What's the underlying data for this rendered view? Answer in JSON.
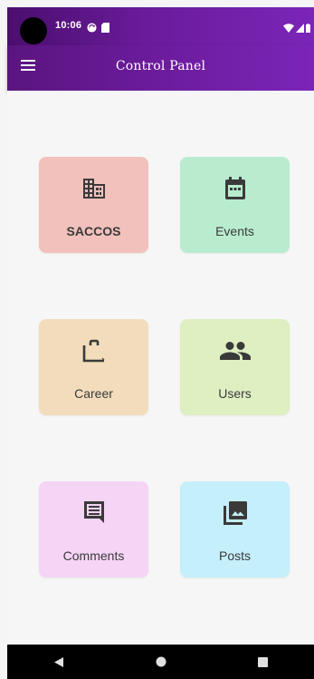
{
  "status_bar": {
    "time": "10:06",
    "icons": [
      "sync-icon",
      "sd-card-icon",
      "wifi-icon",
      "signal-icon",
      "battery-icon"
    ]
  },
  "app_bar": {
    "title": "Control Panel",
    "menu_icon": "menu-icon",
    "gradient": [
      "#5a157e",
      "#7b25b8"
    ]
  },
  "tiles": [
    {
      "label": "SACCOS",
      "icon": "business-icon",
      "color": "#f2c1bc"
    },
    {
      "label": "Events",
      "icon": "calendar-icon",
      "color": "#b9eccf"
    },
    {
      "label": "Career",
      "icon": "work-icon",
      "color": "#f2dcbb"
    },
    {
      "label": "Users",
      "icon": "people-icon",
      "color": "#deefc2"
    },
    {
      "label": "Comments",
      "icon": "comment-icon",
      "color": "#f6d4f5"
    },
    {
      "label": "Posts",
      "icon": "photo-library-icon",
      "color": "#c4effb"
    }
  ],
  "nav_bar": {
    "buttons": [
      "back-icon",
      "home-icon",
      "recents-icon"
    ]
  }
}
